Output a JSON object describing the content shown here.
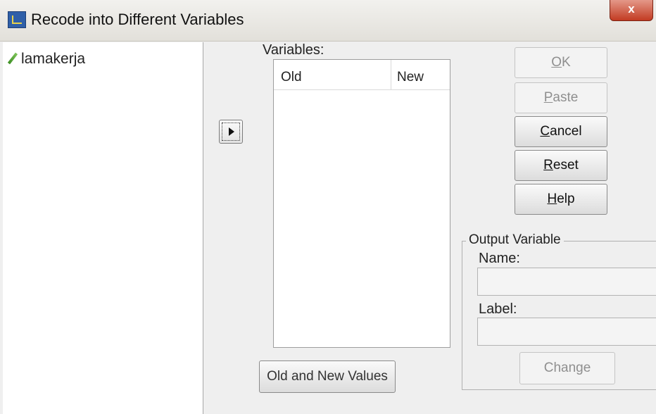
{
  "window": {
    "title": "Recode into Different Variables",
    "close_label": "x"
  },
  "source_list": {
    "items": [
      {
        "label": "lamakerja",
        "icon": "scale-variable-pencil-icon"
      }
    ]
  },
  "variables": {
    "label": "Variables:",
    "columns": {
      "old": "Old",
      "new": "New"
    },
    "rows": []
  },
  "buttons": {
    "ok": {
      "accel": "O",
      "rest": "K",
      "enabled": false
    },
    "paste": {
      "accel": "P",
      "rest": "aste",
      "enabled": false
    },
    "cancel": {
      "accel": "C",
      "rest": "ancel",
      "enabled": true
    },
    "reset": {
      "accel": "R",
      "rest": "eset",
      "enabled": true
    },
    "help": {
      "accel": "H",
      "rest": "elp",
      "enabled": true
    }
  },
  "old_new_button": "Old and New Values",
  "output_variable": {
    "legend": "Output Variable",
    "name_label": "Name:",
    "name_value": "",
    "label_label": "Label:",
    "label_value": "",
    "change_button": "Change"
  },
  "colors": {
    "close_button": "#c23b22",
    "pencil": "#3c8f23"
  }
}
